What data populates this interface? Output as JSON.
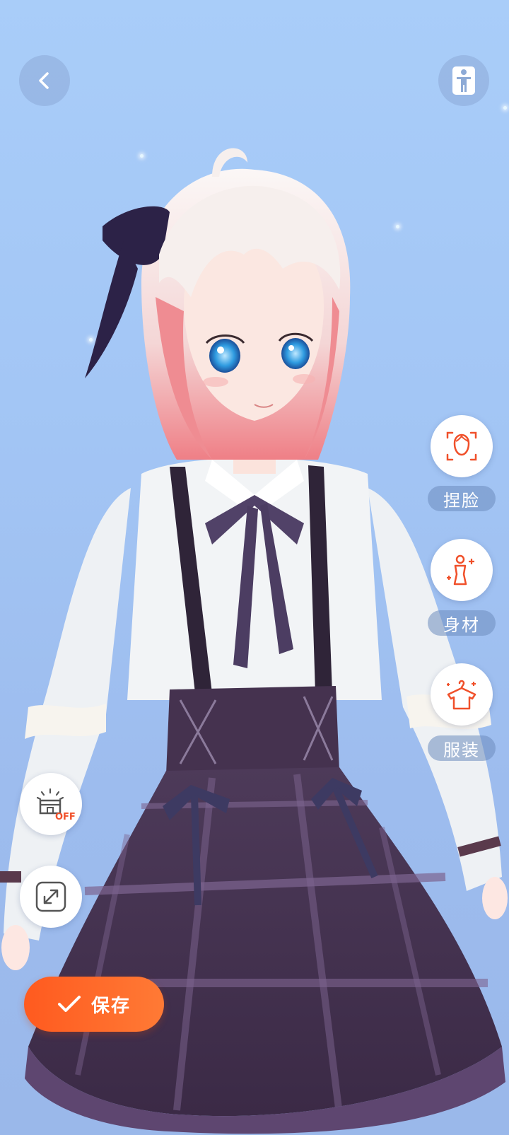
{
  "toolbar": {
    "face_label": "捏脸",
    "body_label": "身材",
    "outfit_label": "服装"
  },
  "left_tools": {
    "lamp_badge": "OFF"
  },
  "save": {
    "label": "保存"
  },
  "colors": {
    "accent": "#FF5A1F",
    "icon_orange": "#F0502A",
    "background": "#A9CDF9"
  },
  "icons": [
    "back-arrow-icon",
    "standing-pose-icon",
    "face-adjust-icon",
    "body-shape-icon",
    "outfit-hanger-icon",
    "lamp-off-icon",
    "expand-icon",
    "check-icon"
  ]
}
